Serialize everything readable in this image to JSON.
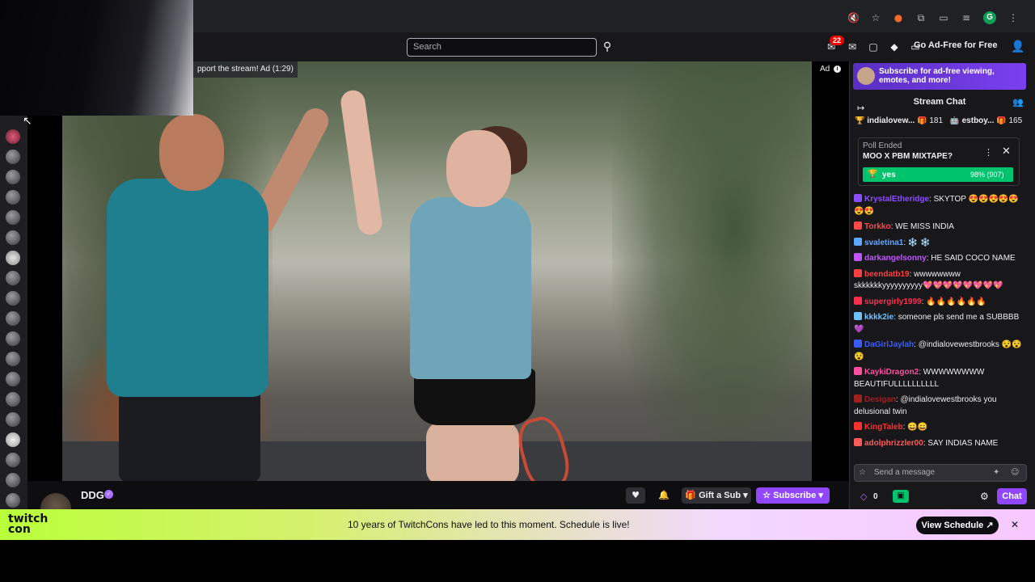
{
  "browser": {
    "icons": [
      "mute-tab-icon",
      "star-icon",
      "extension-brave-icon",
      "puzzle-icon",
      "split-screen-icon",
      "reading-list-icon"
    ],
    "profile_initial": "G",
    "menu_glyph": "⋮"
  },
  "topnav": {
    "search_placeholder": "Search",
    "notification_count": "22",
    "adfree_label": "Go Ad-Free for Free"
  },
  "video": {
    "ad_banner": "pport the stream! Ad (1:29)",
    "ad_tag": "Ad"
  },
  "channel": {
    "name": "DDG",
    "gift_label": "Gift a Sub",
    "subscribe_label": "Subscribe"
  },
  "chat": {
    "promo_text": "Subscribe for ad-free viewing, emotes, and more!",
    "title": "Stream Chat",
    "leaderboard": [
      {
        "name": "indialovew...",
        "gifts": "181"
      },
      {
        "name": "estboy...",
        "gifts": "165"
      }
    ],
    "poll": {
      "status": "Poll Ended",
      "question": "MOO X PBM MIXTAPE?",
      "option": "yes",
      "result": "98% (907)",
      "percent": 0.98
    },
    "messages": [
      {
        "user": "KrystalEtheridge",
        "color": "#8a4dff",
        "text": ": SKYTOP 😍😍😍😍😍😍😍"
      },
      {
        "user": "Torkko",
        "color": "#ff4a4a",
        "text": ": WE MISS INDIA"
      },
      {
        "user": "svaletina1",
        "color": "#5ea8ff",
        "text": ": ❄️ ❄️"
      },
      {
        "user": "darkangelsonny",
        "color": "#c155ff",
        "text": ": HE SAID COCO NAME"
      },
      {
        "user": "beendatb19",
        "color": "#ff4040",
        "text": ": wwwwwwww skkkkkkyyyyyyyyyy💖💖💖💖💖💖💖💖"
      },
      {
        "user": "supergirly1999",
        "color": "#ff3050",
        "text": ": 🔥🔥🔥🔥🔥🔥"
      },
      {
        "user": "kkkk2ie",
        "color": "#6ec1ff",
        "text": ": someone pls send me a SUBBBB 💜"
      },
      {
        "user": "DaGirlJaylah",
        "color": "#3b5bff",
        "text": ": @indialovewestbrooks 😵😵😵"
      },
      {
        "user": "KaykiDragon2",
        "color": "#ff4fa0",
        "text": ": WWWWWWWW BEAUTIFULLLLLLLLLL"
      },
      {
        "user": "Desigan",
        "color": "#a02020",
        "text": ": @indialovewestbrooks you delusional twin"
      },
      {
        "user": "KingTaleb",
        "color": "#ff3030",
        "text": ": 😄😄"
      },
      {
        "user": "adolphrizzler00",
        "color": "#ff5a5a",
        "text": ": SAY INDIAS NAME"
      }
    ],
    "input_placeholder": "Send a message",
    "points": "0",
    "chat_button": "Chat"
  },
  "banner": {
    "logo": "twitch con",
    "message": "10 years of TwitchCons have led to this moment. Schedule is live!",
    "button": "View Schedule ↗"
  },
  "colors": {
    "twitch_purple": "#9147ff",
    "poll_green": "#00c36e",
    "chat_bg": "#18181b"
  }
}
